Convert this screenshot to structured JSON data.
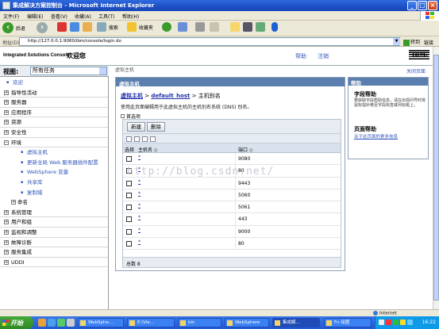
{
  "window": {
    "title": "集成解决方案控制台 - Microsoft Internet Explorer",
    "buttons": [
      "_",
      "□",
      "×"
    ]
  },
  "menubar": [
    "文件(F)",
    "编辑(E)",
    "查看(V)",
    "收藏(A)",
    "工具(T)",
    "帮助(H)"
  ],
  "toolbar": {
    "back": "后退",
    "search": "搜索",
    "favorites": "收藏夹"
  },
  "address": {
    "label": "地址(D)",
    "url": "http://127.0.0.1:9060/ibm/console/login.do",
    "go": "转到",
    "links": "链接"
  },
  "console": {
    "name": "Integrated Solutions Console",
    "welcome": "欢迎您",
    "help_link": "帮助",
    "logout_link": "注销",
    "brand": "IBM.",
    "close_page": "关闭页面"
  },
  "nav": {
    "view_label": "视图:",
    "task_filter": "所有任务",
    "items": [
      {
        "label": "欢迎",
        "kind": "bullet"
      },
      {
        "label": "指导性活动",
        "kind": "plus"
      },
      {
        "label": "服务器",
        "kind": "plus"
      },
      {
        "label": "应用程序",
        "kind": "plus"
      },
      {
        "label": "资源",
        "kind": "plus"
      },
      {
        "label": "安全性",
        "kind": "plus"
      },
      {
        "label": "环境",
        "kind": "minus"
      },
      {
        "label": "虚拟主机",
        "kind": "sub"
      },
      {
        "label": "更新全局 Web 服务器插件配置",
        "kind": "sub"
      },
      {
        "label": "WebSphere 变量",
        "kind": "sub"
      },
      {
        "label": "共享库",
        "kind": "sub"
      },
      {
        "label": "复制域",
        "kind": "sub"
      },
      {
        "label": "命名",
        "kind": "subhead"
      },
      {
        "label": "系统管理",
        "kind": "plus"
      },
      {
        "label": "用户和组",
        "kind": "plus"
      },
      {
        "label": "监视和调整",
        "kind": "plus"
      },
      {
        "label": "故障诊断",
        "kind": "plus"
      },
      {
        "label": "服务集成",
        "kind": "plus"
      },
      {
        "label": "UDDI",
        "kind": "plus"
      }
    ]
  },
  "main": {
    "top_crumb": "虚拟主机",
    "header": "虚拟主机",
    "breadcrumb": {
      "link1": "虚拟主机",
      "sep": ">",
      "link2": "default_host",
      "current": "主机别名"
    },
    "description": "使用此页面编辑用于此虚拟主机的主机别名系统 (DNS) 别名。",
    "preferences": "首选项",
    "buttons": {
      "new": "新建",
      "delete": "删除"
    },
    "columns": {
      "select": "选择",
      "host": "主机名 ◇",
      "port": "端口 ◇"
    },
    "rows": [
      {
        "host": "*",
        "port": "9080"
      },
      {
        "host": "*",
        "port": "80"
      },
      {
        "host": "*",
        "port": "9443"
      },
      {
        "host": "*",
        "port": "5060"
      },
      {
        "host": "*",
        "port": "5061"
      },
      {
        "host": "*",
        "port": "443"
      },
      {
        "host": "*",
        "port": "9000"
      },
      {
        "host": "*",
        "port": "80"
      }
    ],
    "total": "总数 8"
  },
  "help": {
    "header": "帮助",
    "field_help_title": "字段帮助",
    "field_help_text": "要获取字段帮助信息，请在出现问号时将鼠标指针移至字段标签或列标题上。",
    "page_help_title": "页面帮助",
    "page_help_link": "关于此页面的更多信息"
  },
  "watermark": "http://blog.csdn.net/",
  "statusbar": {
    "zone": "Internet"
  },
  "taskbar": {
    "start": "开始",
    "tasks": [
      "WebSphe...",
      "E:\\Vie...",
      "bin",
      "WebSphere",
      "集成解...",
      "Fn 绘图"
    ],
    "clock": "16:22"
  },
  "colors": {
    "title_blue": "#1c4fc4",
    "panel_header": "#5a7eae",
    "link": "#2233aa",
    "taskbar": "#2356d0",
    "start_green": "#2e8a24"
  }
}
